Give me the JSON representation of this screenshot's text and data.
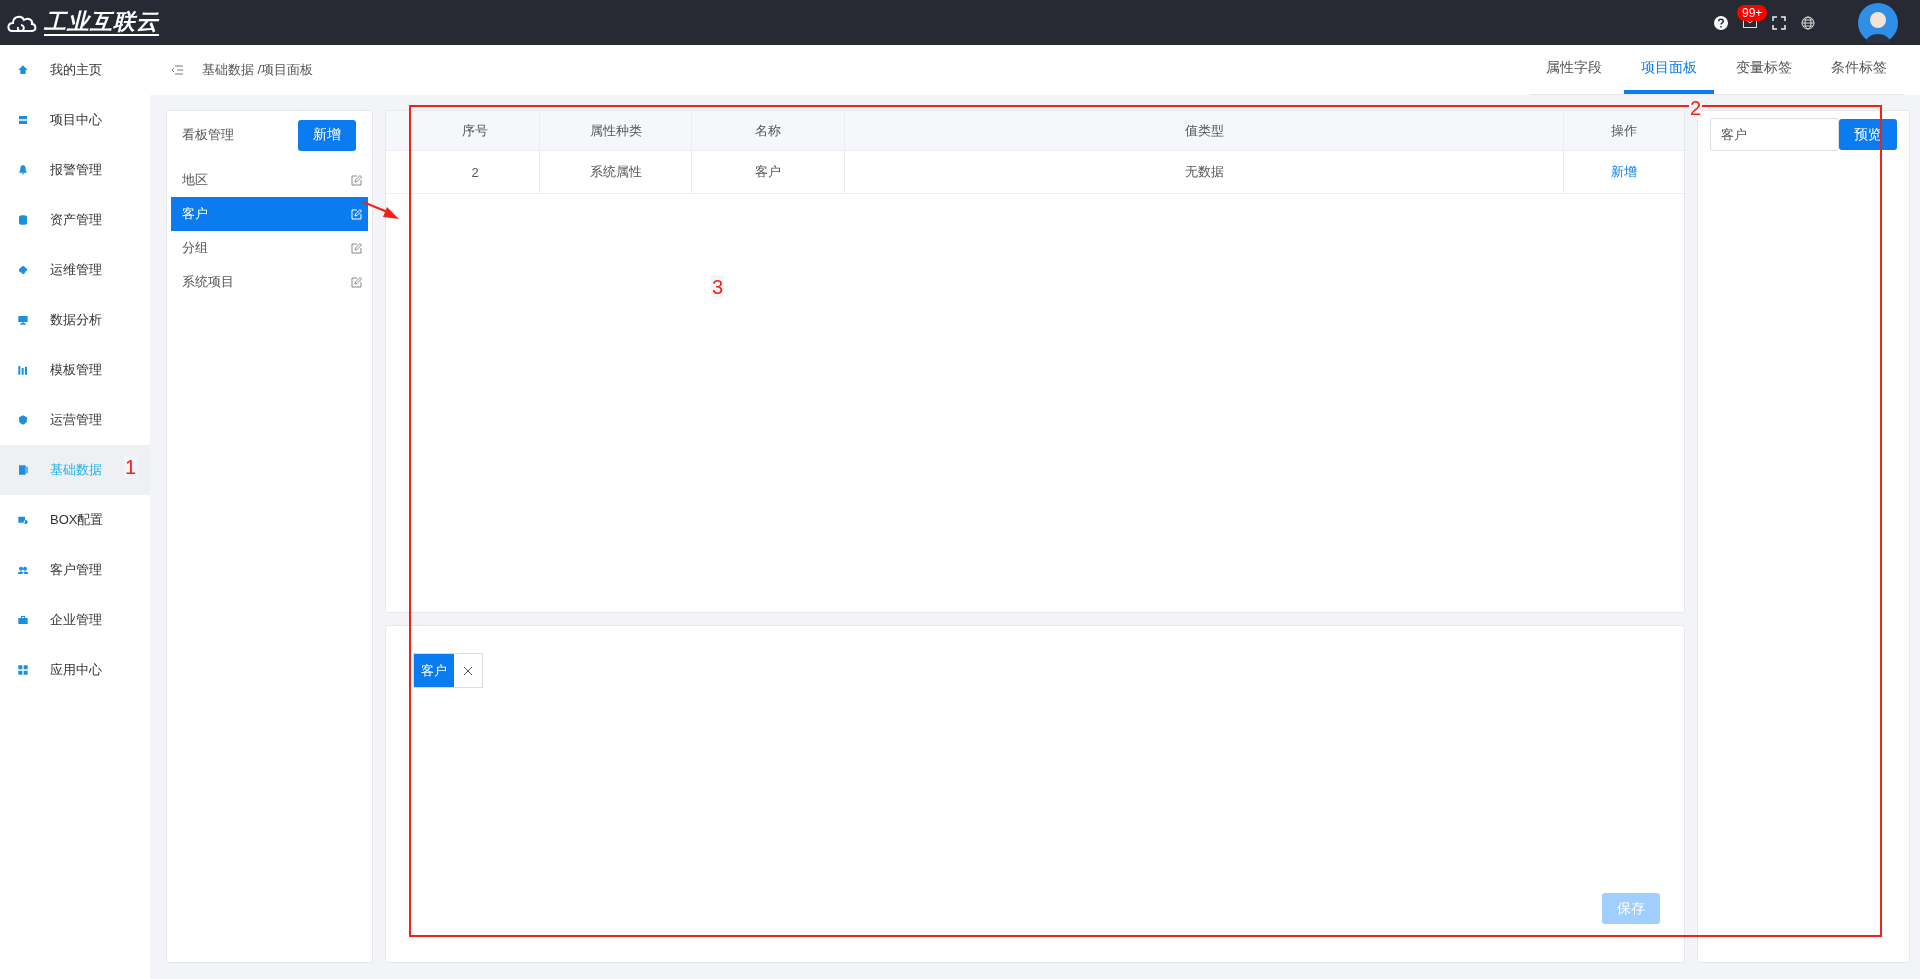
{
  "top_bar": {
    "logo_text": "工业互联云",
    "notification_badge": "99+"
  },
  "sidebar": {
    "items": [
      {
        "label": "我的主页",
        "selected": false
      },
      {
        "label": "项目中心",
        "selected": false
      },
      {
        "label": "报警管理",
        "selected": false
      },
      {
        "label": "资产管理",
        "selected": false
      },
      {
        "label": "运维管理",
        "selected": false
      },
      {
        "label": "数据分析",
        "selected": false
      },
      {
        "label": "模板管理",
        "selected": false
      },
      {
        "label": "运营管理",
        "selected": false
      },
      {
        "label": "基础数据",
        "selected": true
      },
      {
        "label": "BOX配置",
        "selected": false
      },
      {
        "label": "客户管理",
        "selected": false
      },
      {
        "label": "企业管理",
        "selected": false
      },
      {
        "label": "应用中心",
        "selected": false
      }
    ]
  },
  "header": {
    "breadcrumb": "基础数据 /项目面板",
    "tabs": [
      {
        "label": "属性字段",
        "selected": false
      },
      {
        "label": "项目面板",
        "selected": true
      },
      {
        "label": "变量标签",
        "selected": false
      },
      {
        "label": "条件标签",
        "selected": false
      }
    ]
  },
  "board_panel": {
    "title": "看板管理",
    "add_button": "新增",
    "items": [
      {
        "label": "地区",
        "selected": false
      },
      {
        "label": "客户",
        "selected": true
      },
      {
        "label": "分组",
        "selected": false
      },
      {
        "label": "系统项目",
        "selected": false
      }
    ]
  },
  "table": {
    "columns": [
      "序号",
      "属性种类",
      "名称",
      "值类型",
      "操作"
    ],
    "rows": [
      {
        "index": "2",
        "attribute_type": "系统属性",
        "name": "客户",
        "value_type": "无数据",
        "action": "新增"
      }
    ]
  },
  "selected_tags": [
    {
      "label": "客户"
    }
  ],
  "save_button": {
    "label": "保存",
    "disabled": true
  },
  "preview": {
    "input_value": "客户",
    "button": "预览"
  },
  "annotations": [
    {
      "kind": "number",
      "text": "1"
    },
    {
      "kind": "number",
      "text": "2"
    },
    {
      "kind": "number",
      "text": "3"
    },
    {
      "kind": "rectangle"
    },
    {
      "kind": "arrow"
    }
  ]
}
